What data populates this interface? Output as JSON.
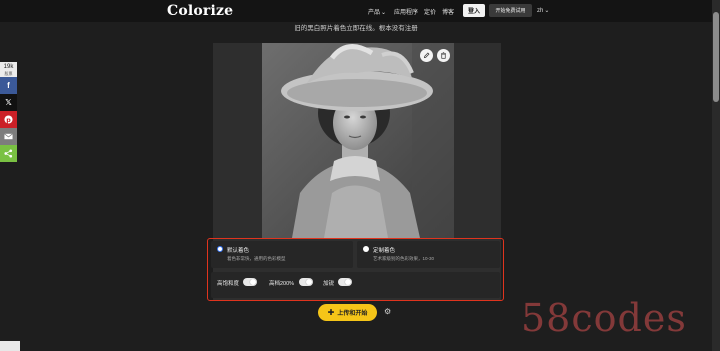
{
  "header": {
    "logo": "Colorize",
    "nav": {
      "products": "产品",
      "apps": "应用程序",
      "pricing": "定价",
      "blog": "博客"
    },
    "login": "登入",
    "trial": "开始免费试用",
    "lang": "zh"
  },
  "subtitle": "旧的黑白照片着色立即在线。根本没有注册",
  "share": {
    "count": "19k",
    "count_label": "股票"
  },
  "options": {
    "default_title": "默认着色",
    "default_desc": "着色非常快，通用的色彩模型",
    "custom_title": "定制着色",
    "custom_desc": "艺术家级别的色彩效果，10-30"
  },
  "toggles": {
    "saturation": "高饱和度",
    "resolution": "高档200%",
    "sharpen": "加锐"
  },
  "upload": {
    "label": "上传和开始"
  },
  "watermark": "58codes",
  "colors": {
    "accent": "#f5c518",
    "outline": "#e0341e",
    "radio": "#3a7bff"
  },
  "icons": [
    "pencil-icon",
    "trash-icon",
    "facebook-icon",
    "x-icon",
    "pinterest-icon",
    "mail-icon",
    "share-icon",
    "gear-icon",
    "plus-icon",
    "chevron-down-icon"
  ]
}
